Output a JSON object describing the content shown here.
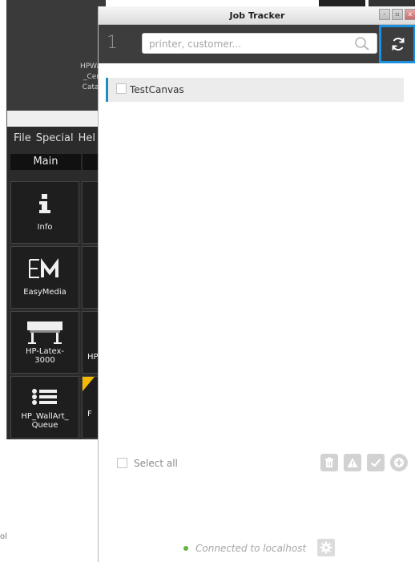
{
  "background_app": {
    "caption_lines": [
      "HPWa",
      "_Cen",
      "Catal"
    ],
    "menu": [
      "File",
      "Special",
      "Hel"
    ],
    "tab_main": "Main",
    "tiles": [
      {
        "label": "Info",
        "icon": "info-icon"
      },
      {
        "label": "EasyMedia",
        "icon": "easymedia-icon"
      },
      {
        "label": "HP-Latex-\n3000",
        "icon": "printer-icon"
      },
      {
        "label": "HP_WallArt_\nQueue",
        "icon": "queue-list-icon"
      }
    ],
    "partial_tile_labels": [
      "HP",
      "F"
    ],
    "footer_fragment": "ol"
  },
  "job_tracker": {
    "title": "Job Tracker",
    "window_buttons": [
      "-",
      "▫",
      "x"
    ],
    "job_count": "1",
    "search": {
      "placeholder": "printer, customer...",
      "value": ""
    },
    "jobs": [
      {
        "name": "TestCanvas",
        "checked": false
      }
    ],
    "select_all_label": "Select all",
    "actions": [
      "delete-icon",
      "warning-icon",
      "check-icon",
      "add-icon"
    ],
    "status": {
      "text": "Connected to localhost",
      "color": "#63b33a"
    },
    "accent_color": "#1b8fe0"
  }
}
